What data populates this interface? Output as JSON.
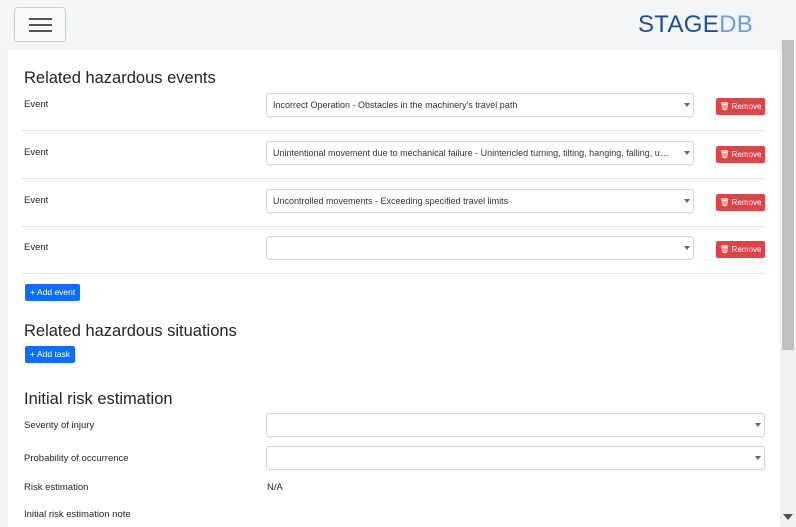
{
  "brand": {
    "part1": "STAGE",
    "part2": "DB",
    "color_dark": "#1e4f8c",
    "color_light": "#6fa0cf"
  },
  "events_section": {
    "title": "Related hazardous events",
    "rows": [
      {
        "label": "Event",
        "value": "Incorrect Operation - Obstacles in the machinery's travel path",
        "remove_label": "Remove"
      },
      {
        "label": "Event",
        "value": "Unintentional movement due to mechanical failure - Unintencled turning, tilting, hanging, falling, un...",
        "remove_label": "Remove"
      },
      {
        "label": "Event",
        "value": "Uncontrolled movements - Exceeding specified travel limits",
        "remove_label": "Remove"
      },
      {
        "label": "Event",
        "value": "",
        "remove_label": "Remove"
      }
    ],
    "add_label": "Add event"
  },
  "situations_section": {
    "title": "Related hazardous situations",
    "add_label": "Add task"
  },
  "risk_section": {
    "title": "Initial risk estimation",
    "severity_label": "Severity of injury",
    "severity_value": "",
    "probability_label": "Probability of occurrence",
    "probability_value": "",
    "estimation_label": "Risk estimation",
    "estimation_value": "N/A",
    "note_label": "Initial risk estimation note"
  },
  "colors": {
    "remove": "#dc4448",
    "primary": "#0d6efd"
  },
  "icons": {
    "menu": "hamburger-icon",
    "remove": "trash-icon",
    "add": "plus-icon",
    "dropdown": "chevron-down-icon"
  }
}
